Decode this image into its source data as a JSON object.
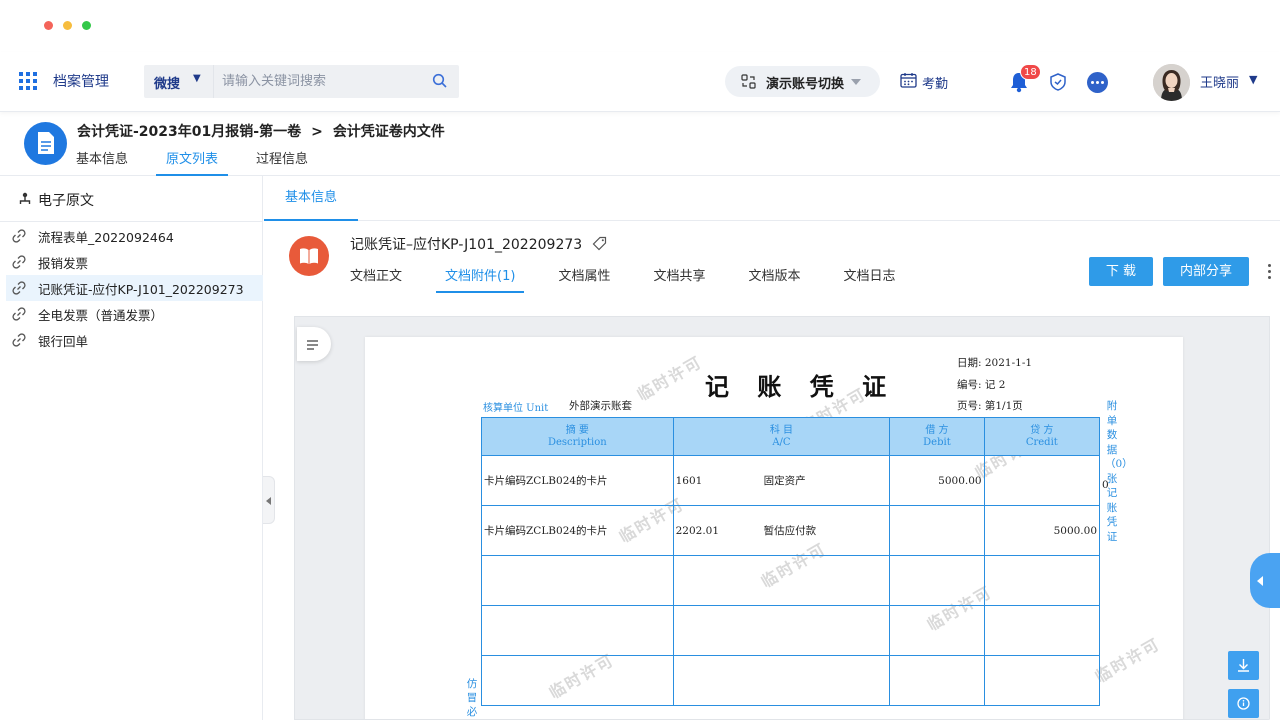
{
  "app": {
    "name": "档案管理",
    "accent_color": "#1f8fe8",
    "nav_color": "#1f3a8a"
  },
  "search": {
    "type_label": "微搜",
    "placeholder": "请输入关键词搜索"
  },
  "topbar": {
    "switch_label": "演示账号切换",
    "attendance_label": "考勤",
    "notification_count": "18",
    "user_name": "王晓丽"
  },
  "header": {
    "crumb_parent": "会计凭证-2023年01月报销-第一卷",
    "crumb_sep": ">",
    "crumb_current": "会计凭证卷内文件",
    "tabs": [
      {
        "label": "基本信息"
      },
      {
        "label": "原文列表"
      },
      {
        "label": "过程信息"
      }
    ]
  },
  "sidebar": {
    "title": "电子原文",
    "items": [
      {
        "label": "流程表单_2022092464"
      },
      {
        "label": "报销发票"
      },
      {
        "label": "记账凭证-应付KP-J101_202209273"
      },
      {
        "label": "全电发票（普通发票）"
      },
      {
        "label": "银行回单"
      }
    ]
  },
  "main": {
    "tab_label": "基本信息",
    "file_title": "记账凭证–应付KP-J101_202209273",
    "file_tabs": [
      {
        "label": "文档正文"
      },
      {
        "label": "文档附件(1)"
      },
      {
        "label": "文档属性"
      },
      {
        "label": "文档共享"
      },
      {
        "label": "文档版本"
      },
      {
        "label": "文档日志"
      }
    ],
    "download_label": "下 载",
    "share_label": "内部分享"
  },
  "voucher": {
    "date": "日期:  2021-1-1",
    "title": "记 账 凭 证",
    "number": "编号:  记        2",
    "unit_label": "核算单位 Unit",
    "unit_value": "外部演示账套",
    "page": "页号:  第1/1页",
    "headers": {
      "desc_cn": "摘      要",
      "desc_en": "Description",
      "ac_cn": "科      目",
      "ac_en": "A/C",
      "debit_cn": "借  方",
      "debit_en": "Debit",
      "credit_cn": "贷  方",
      "credit_en": "Credit"
    },
    "rows": [
      {
        "desc": "卡片编码ZCLB024的卡片",
        "code": "1601",
        "account": "固定资产",
        "debit": "5000.00",
        "credit": ""
      },
      {
        "desc": "卡片编码ZCLB024的卡片",
        "code": "2202.01",
        "account": "暂估应付款",
        "debit": "",
        "credit": "5000.00"
      },
      {
        "desc": "",
        "code": "",
        "account": "",
        "debit": "",
        "credit": ""
      },
      {
        "desc": "",
        "code": "",
        "account": "",
        "debit": "",
        "credit": ""
      },
      {
        "desc": "",
        "code": "",
        "account": "",
        "debit": "",
        "credit": ""
      }
    ],
    "side_right": "附单数据（0）张记账凭证",
    "side_right_count": "0",
    "side_left": "仿冒必",
    "watermark": "临时许可"
  }
}
